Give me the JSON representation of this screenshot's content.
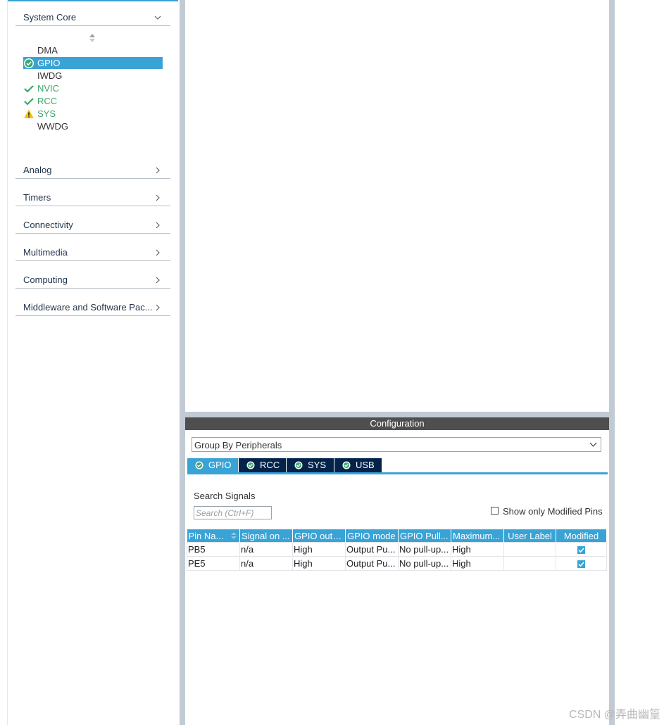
{
  "sidebar": {
    "categories": [
      {
        "label": "System Core",
        "state": "expanded"
      },
      {
        "label": "Analog",
        "state": "collapsed"
      },
      {
        "label": "Timers",
        "state": "collapsed"
      },
      {
        "label": "Connectivity",
        "state": "collapsed"
      },
      {
        "label": "Multimedia",
        "state": "collapsed"
      },
      {
        "label": "Computing",
        "state": "collapsed"
      },
      {
        "label": "Middleware and Software Pac...",
        "state": "collapsed"
      }
    ],
    "peripherals": [
      {
        "label": "DMA",
        "status": "none",
        "icon": ""
      },
      {
        "label": "GPIO",
        "status": "selected",
        "icon": "check-circle-icon"
      },
      {
        "label": "IWDG",
        "status": "none",
        "icon": ""
      },
      {
        "label": "NVIC",
        "status": "ok",
        "icon": "check-icon"
      },
      {
        "label": "RCC",
        "status": "ok",
        "icon": "check-icon"
      },
      {
        "label": "SYS",
        "status": "warning",
        "icon": "warning-icon"
      },
      {
        "label": "WWDG",
        "status": "none",
        "icon": ""
      }
    ]
  },
  "config": {
    "title": "Configuration",
    "group_by": "Group By Peripherals",
    "tabs": [
      {
        "label": "GPIO",
        "active": true
      },
      {
        "label": "RCC",
        "active": false
      },
      {
        "label": "SYS",
        "active": false
      },
      {
        "label": "USB",
        "active": false
      }
    ],
    "search_label": "Search Signals",
    "search_placeholder": "Search (Ctrl+F)",
    "show_modified_label": "Show only Modified Pins",
    "show_modified_checked": false,
    "table": {
      "columns": [
        "Pin Na...",
        "Signal on ...",
        "GPIO outp...",
        "GPIO mode",
        "GPIO Pull...",
        "Maximum...",
        "User Label",
        "Modified"
      ],
      "rows": [
        [
          "PB5",
          "n/a",
          "High",
          "Output Pu...",
          "No pull-up...",
          "High",
          "",
          true
        ],
        [
          "PE5",
          "n/a",
          "High",
          "Output Pu...",
          "No pull-up...",
          "High",
          "",
          true
        ]
      ]
    }
  },
  "watermark": "CSDN @弄曲幽篁",
  "colors": {
    "accent": "#3aa3d6",
    "tab_dark": "#03234b",
    "ok_green": "#3aa86a",
    "warn_yellow": "#f2c500",
    "config_bar": "#4f4f4f"
  }
}
